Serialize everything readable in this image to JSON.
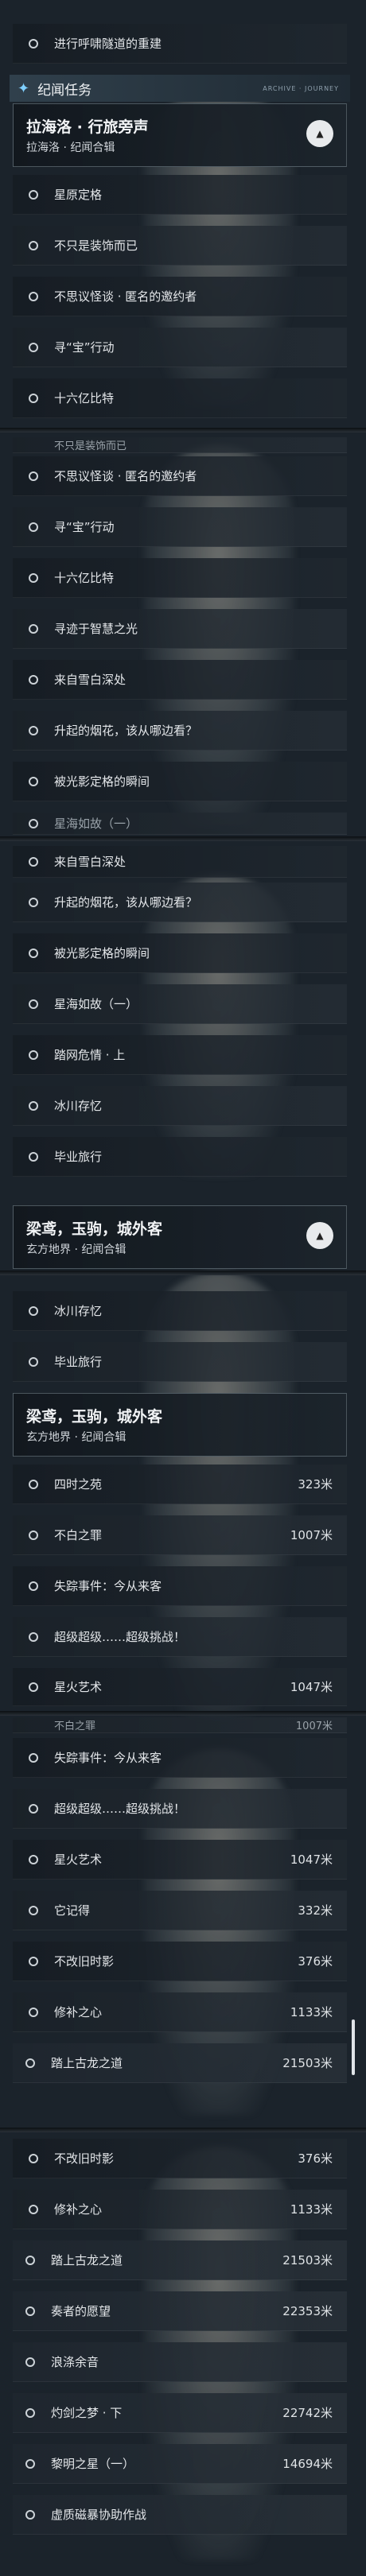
{
  "category": {
    "label": "纪闻任务",
    "decoration": "ARCHIVE · JOURNEY"
  },
  "top_item": "进行呼啸隧道的重建",
  "groups": {
    "lahailuo": {
      "title": "拉海洛 · 行旅旁声",
      "subtitle": "拉海洛 · 纪闻合辑",
      "collapse_icon": "▲"
    },
    "liangniao": {
      "title": "梁鸢，玉驹，城外客",
      "subtitle": "玄方地界 · 纪闻合辑",
      "collapse_icon": "▲"
    }
  },
  "quests": {
    "q1": "星原定格",
    "q2": "不只是装饰而已",
    "q3": "不思议怪谈 · 匿名的邀约者",
    "q4": "寻“宝”行动",
    "q5": "十六亿比特",
    "q6": "寻迹于智慧之光",
    "q7": "来自雪白深处",
    "q8": "升起的烟花，该从哪边看？",
    "q9": "被光影定格的瞬间",
    "q10": "星海如故（一）",
    "q11": "踏网危情 · 上",
    "q12": "冰川存忆",
    "q13": "毕业旅行",
    "q14": "四时之苑",
    "q15": "不白之罪",
    "q16": "失踪事件：今从来客",
    "q17": "超级超级……超级挑战！",
    "q18": "星火艺术",
    "q19": "它记得",
    "q20": "不改旧时影",
    "q21": "修补之心",
    "q22": "踏上古龙之道",
    "q23": "奏者的愿望",
    "q24": "浪涤余音",
    "q25": "灼剑之梦 · 下",
    "q26": "黎明之星（一）",
    "q27": "虚质磁暴协助作战"
  },
  "distances": {
    "q14": "323米",
    "q15": "1007米",
    "q18": "1047米",
    "q19": "332米",
    "q20": "376米",
    "q21": "1133米",
    "q22": "21503米",
    "q23": "22353米",
    "q25": "22742米",
    "q26": "14694米"
  }
}
